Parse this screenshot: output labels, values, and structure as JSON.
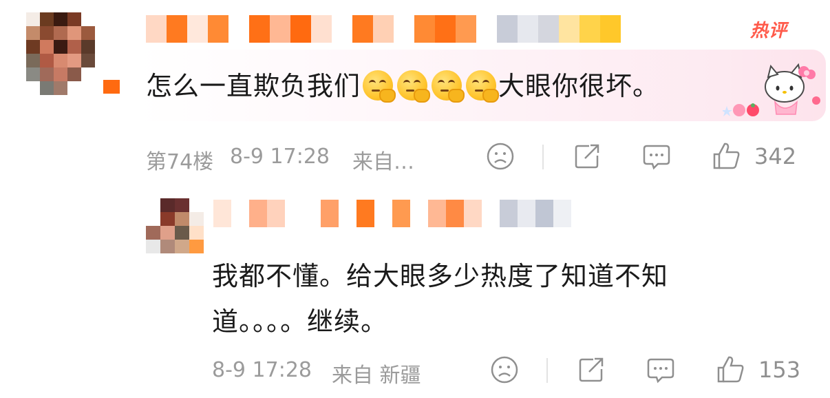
{
  "comments": [
    {
      "badge": "热评",
      "text_before": "怎么一直欺负我们",
      "emoji_name": "thinking-face-emoji",
      "emoji_count": 4,
      "text_after": "大眼你很坏。",
      "floor": "第74楼",
      "time": "8-9 17:28",
      "source": "来自…",
      "likes": "342"
    }
  ],
  "reply": {
    "line1": "我都不懂。给大眼多少热度了知道不知",
    "line2": "道。。。。继续。",
    "time": "8-9 17:28",
    "source": "来自 新疆",
    "likes": "153"
  },
  "icons": [
    "sad-face-icon",
    "share-icon",
    "comment-icon",
    "like-icon"
  ],
  "colors": {
    "hot": "#ff5a4a",
    "meta": "#9b9b9b",
    "pink_band": "#fde3ec"
  }
}
